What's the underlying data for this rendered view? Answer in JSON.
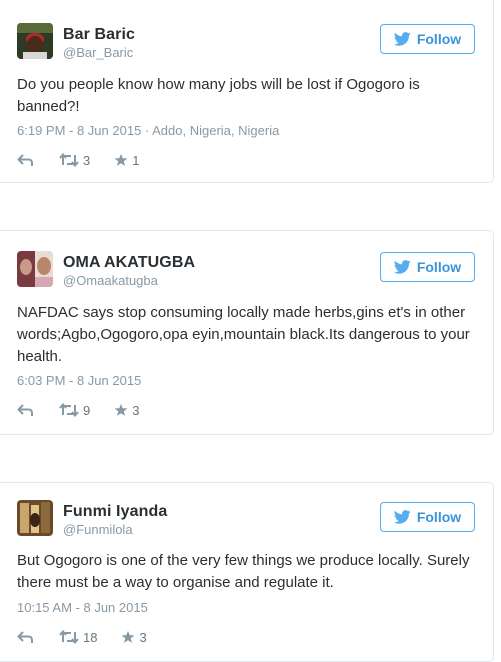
{
  "tweets": [
    {
      "name": "Bar Baric",
      "handle": "@Bar_Baric",
      "follow_label": "Follow",
      "text": "Do you people know how many jobs will be lost if Ogogoro is banned?!",
      "meta": "6:19 PM - 8 Jun 2015 · Addo, Nigeria, Nigeria",
      "retweets": "3",
      "favorites": "1"
    },
    {
      "name": "OMA AKATUGBA",
      "handle": "@Omaakatugba",
      "follow_label": "Follow",
      "text": "NAFDAC says stop consuming locally made herbs,gins et's in other words;Agbo,Ogogoro,opa eyin,mountain black.Its dangerous to your health.",
      "meta": "6:03 PM - 8 Jun 2015",
      "retweets": "9",
      "favorites": "3"
    },
    {
      "name": "Funmi Iyanda",
      "handle": "@Funmilola",
      "follow_label": "Follow",
      "text": "But Ogogoro is one of the very few things we produce locally. Surely there must be a way to organise and regulate it.",
      "meta": "10:15 AM - 8 Jun 2015",
      "retweets": "18",
      "favorites": "3"
    }
  ],
  "icons": {
    "follow": "twitter-bird-icon",
    "reply": "reply-icon",
    "retweet": "retweet-icon",
    "favorite": "star-icon"
  },
  "colors": {
    "accent": "#55acee",
    "follow_text": "#3b94d9",
    "muted": "#8899a6",
    "text": "#292f33",
    "border": "#e1e8ed"
  }
}
